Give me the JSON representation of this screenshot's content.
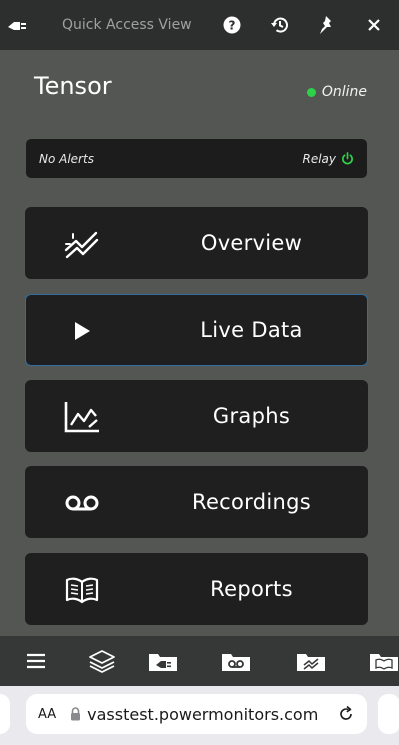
{
  "topbar": {
    "title": "Quick Access View",
    "icons": [
      "plug-icon",
      "help-icon",
      "history-icon",
      "pin-icon",
      "close-icon"
    ]
  },
  "header": {
    "device_name": "Tensor",
    "status": "Online",
    "status_color": "#2ed24a"
  },
  "alerts": {
    "text": "No Alerts",
    "relay_label": "Relay",
    "relay_color": "#2ed24a"
  },
  "menu": {
    "items": [
      {
        "label": "Overview",
        "icon": "overview-icon"
      },
      {
        "label": "Live Data",
        "icon": "play-icon",
        "active": true
      },
      {
        "label": "Graphs",
        "icon": "graph-icon"
      },
      {
        "label": "Recordings",
        "icon": "voicemail-icon"
      },
      {
        "label": "Reports",
        "icon": "book-icon"
      }
    ],
    "active_border_color": "#2f6e9e"
  },
  "toolbar": {
    "icons": [
      "hamburger-menu-icon",
      "layers-icon",
      "folder-plug-icon",
      "folder-recordings-icon",
      "folder-overview-icon",
      "folder-reports-icon"
    ]
  },
  "browser": {
    "aa_label": "AA",
    "url": "vasstest.powermonitors.com"
  }
}
